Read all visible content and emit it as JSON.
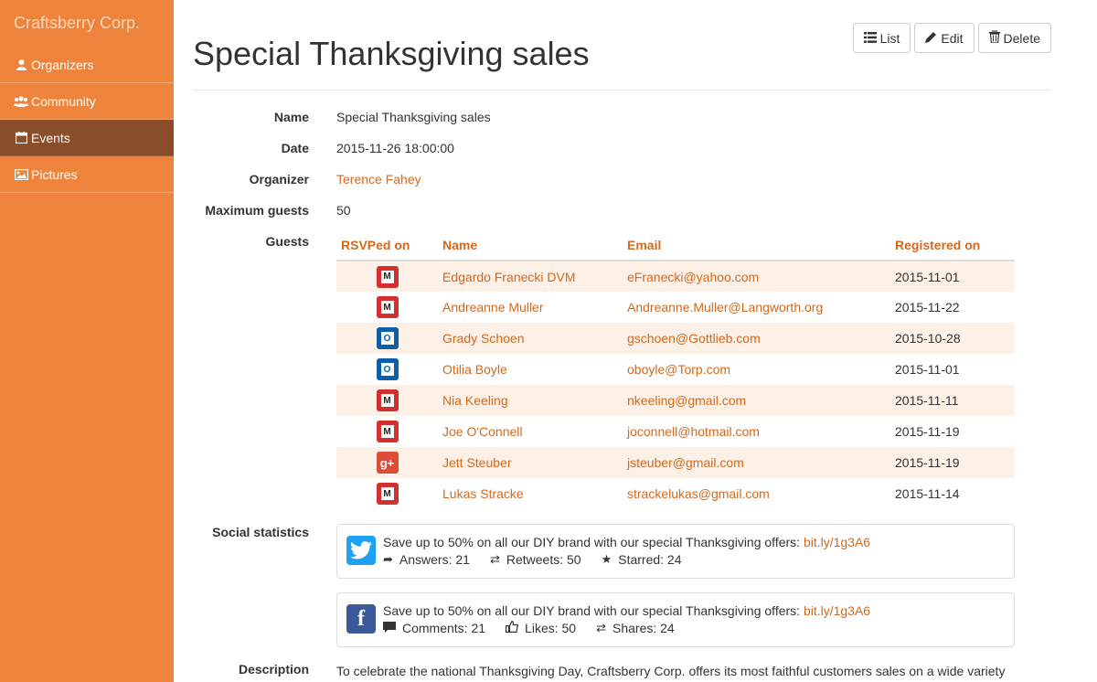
{
  "brand": "Craftsberry Corp.",
  "sidebar": {
    "items": [
      {
        "label": "Organizers",
        "icon": "user-icon"
      },
      {
        "label": "Community",
        "icon": "users-icon"
      },
      {
        "label": "Events",
        "icon": "calendar-icon",
        "active": true
      },
      {
        "label": "Pictures",
        "icon": "picture-icon"
      }
    ]
  },
  "page": {
    "title": "Special Thanksgiving sales"
  },
  "toolbar": {
    "list_label": "List",
    "edit_label": "Edit",
    "delete_label": "Delete"
  },
  "details": {
    "name_label": "Name",
    "name_value": "Special Thanksgiving sales",
    "date_label": "Date",
    "date_value": "2015-11-26 18:00:00",
    "organizer_label": "Organizer",
    "organizer_value": "Terence Fahey",
    "max_guests_label": "Maximum guests",
    "max_guests_value": "50",
    "guests_label": "Guests",
    "social_label": "Social statistics",
    "description_label": "Description",
    "description_value": "To celebrate the national Thanksgiving Day, Craftsberry Corp. offers its most faithful customers sales on a wide variety"
  },
  "guests": {
    "columns": [
      "RSVPed on",
      "Name",
      "Email",
      "Registered on"
    ],
    "rows": [
      {
        "rsvp": "m",
        "name": "Edgardo Franecki DVM",
        "email": "eFranecki@yahoo.com",
        "registered": "2015-11-01"
      },
      {
        "rsvp": "m",
        "name": "Andreanne Muller",
        "email": "Andreanne.Muller@Langworth.org",
        "registered": "2015-11-22"
      },
      {
        "rsvp": "o",
        "name": "Grady Schoen",
        "email": "gschoen@Gottlieb.com",
        "registered": "2015-10-28"
      },
      {
        "rsvp": "o",
        "name": "Otilia Boyle",
        "email": "oboyle@Torp.com",
        "registered": "2015-11-01"
      },
      {
        "rsvp": "m",
        "name": "Nia Keeling",
        "email": "nkeeling@gmail.com",
        "registered": "2015-11-11"
      },
      {
        "rsvp": "m",
        "name": "Joe O'Connell",
        "email": "joconnell@hotmail.com",
        "registered": "2015-11-19"
      },
      {
        "rsvp": "g",
        "name": "Jett Steuber",
        "email": "jsteuber@gmail.com",
        "registered": "2015-11-19"
      },
      {
        "rsvp": "m",
        "name": "Lukas Stracke",
        "email": "strackelukas@gmail.com",
        "registered": "2015-11-14"
      }
    ]
  },
  "social": {
    "twitter": {
      "message": "Save up to 50% on all our DIY brand with our special Thanksgiving offers: ",
      "link": "bit.ly/1g3A6",
      "answers": "Answers: 21",
      "retweets": "Retweets: 50",
      "starred": "Starred: 24"
    },
    "facebook": {
      "message": "Save up to 50% on all our DIY brand with our special Thanksgiving offers: ",
      "link": "bit.ly/1g3A6",
      "comments": "Comments: 21",
      "likes": "Likes: 50",
      "shares": "Shares: 24"
    }
  },
  "colors": {
    "sidebar": "#ee843c",
    "sidebar_active": "#8a4e2a",
    "accent": "#d2691e"
  }
}
